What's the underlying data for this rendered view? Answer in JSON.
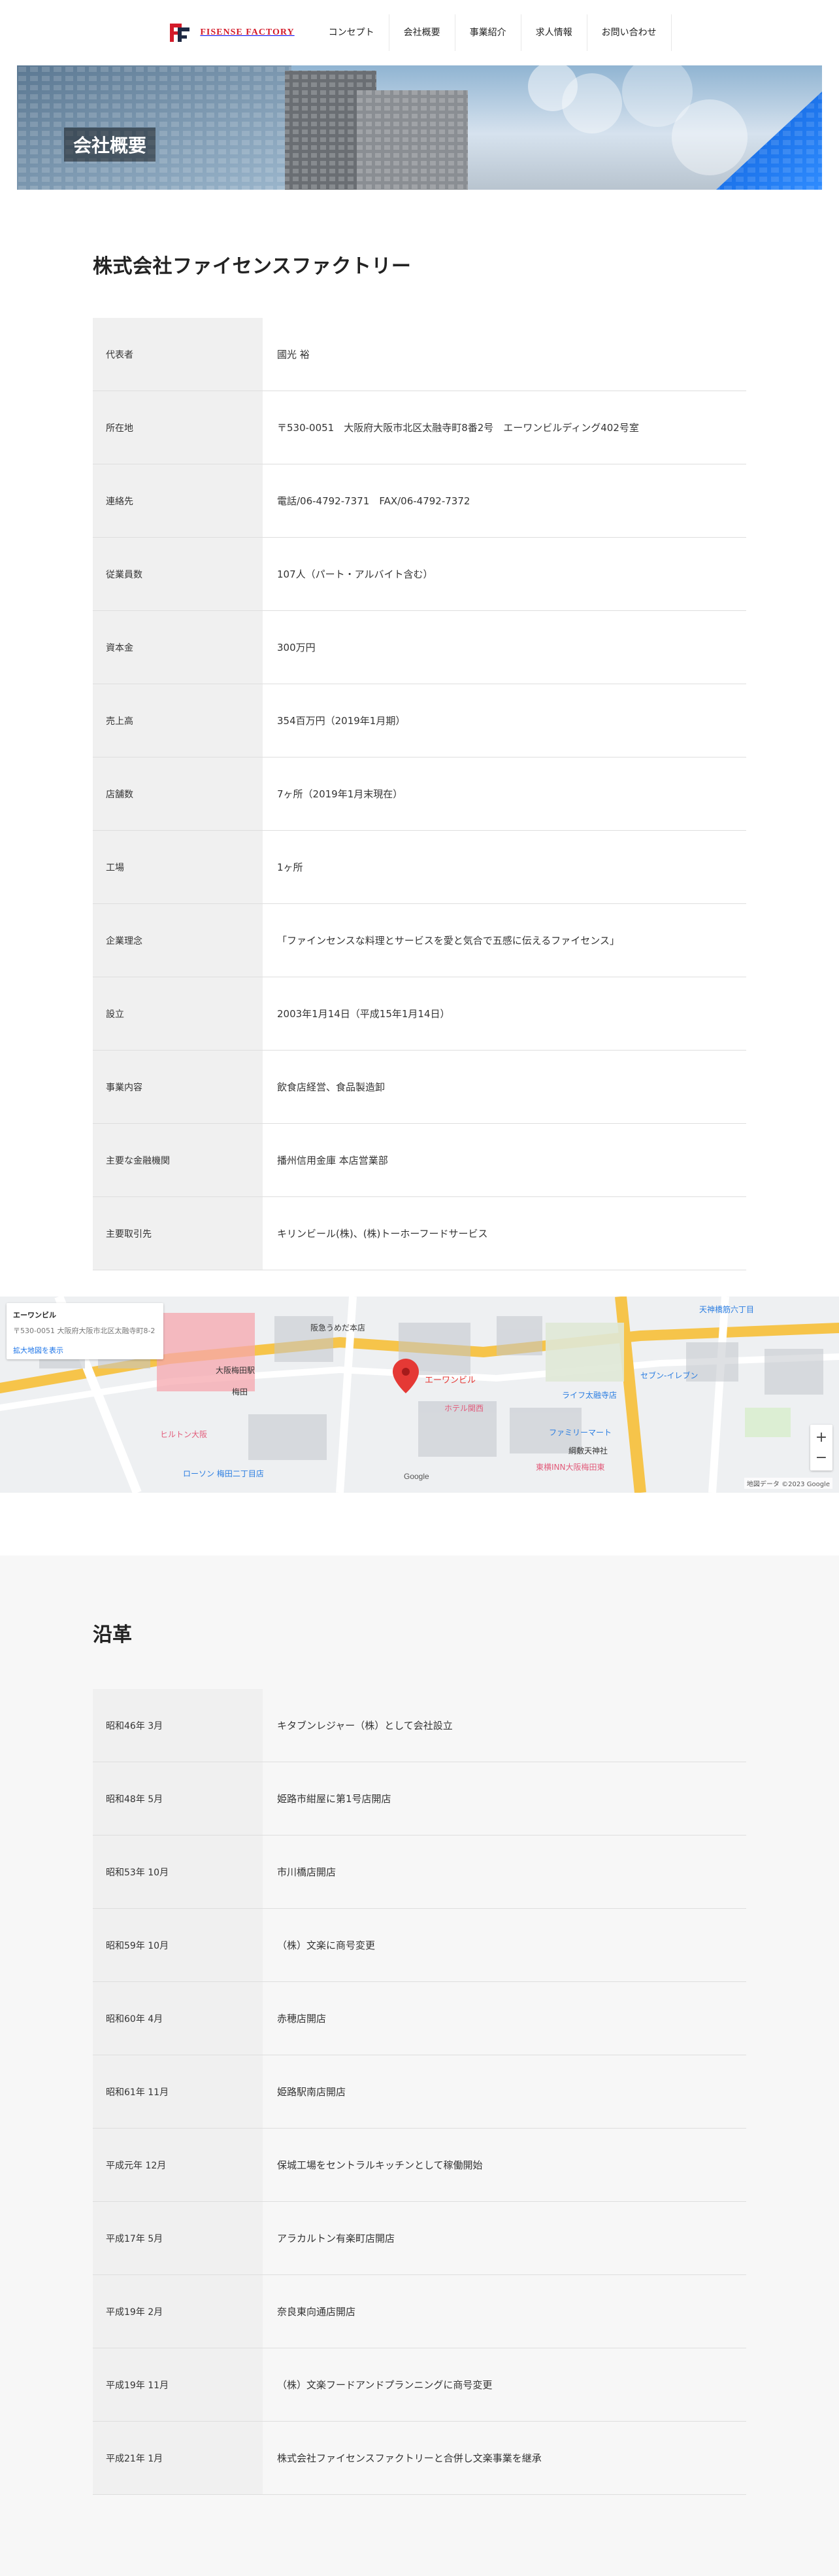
{
  "header": {
    "logo_text": "FISENSE FACTORY",
    "nav": [
      {
        "label": "コンセプト"
      },
      {
        "label": "会社概要"
      },
      {
        "label": "事業紹介"
      },
      {
        "label": "求人情報"
      },
      {
        "label": "お問い合わせ"
      }
    ]
  },
  "hero": {
    "badge": "会社概要"
  },
  "company": {
    "name": "株式会社ファイセンスファクトリー",
    "rows": [
      {
        "label": "代表者",
        "value": "國光 裕"
      },
      {
        "label": "所在地",
        "value": "〒530-0051　大阪府大阪市北区太融寺町8番2号　エーワンビルディング402号室"
      },
      {
        "label": "連絡先",
        "value": "電話/06-4792-7371　FAX/06-4792-7372"
      },
      {
        "label": "従業員数",
        "value": "107人（パート・アルバイト含む）"
      },
      {
        "label": "資本金",
        "value": "300万円"
      },
      {
        "label": "売上高",
        "value": "354百万円（2019年1月期）"
      },
      {
        "label": "店舗数",
        "value": "7ヶ所（2019年1月末現在）"
      },
      {
        "label": "工場",
        "value": "1ヶ所"
      },
      {
        "label": "企業理念",
        "value": "「ファインセンスな料理とサービスを愛と気合で五感に伝えるファイセンス」"
      },
      {
        "label": "設立",
        "value": "2003年1月14日（平成15年1月14日）"
      },
      {
        "label": "事業内容",
        "value": "飲食店経営、食品製造卸"
      },
      {
        "label": "主要な金融機関",
        "value": "播州信用金庫 本店営業部"
      },
      {
        "label": "主要取引先",
        "value": "キリンビール(株)、(株)トーホーフードサービス"
      }
    ]
  },
  "map": {
    "card_line1": "エーワンビル",
    "card_line2": "〒530-0051 大阪府大阪市北区太融寺町8-2",
    "card_line3": "拡大地図を表示",
    "pin_label": "エーワンビル",
    "google_label": "Google",
    "credit": "地図データ ©2023 Google",
    "zoom_in": "+",
    "zoom_out": "−",
    "place_labels": [
      {
        "text": "阪急うめだ本店"
      },
      {
        "text": "大阪梅田駅"
      },
      {
        "text": "梅田"
      },
      {
        "text": "ヒルトン大阪"
      },
      {
        "text": "ファミリーマート"
      },
      {
        "text": "セブン-イレブン"
      },
      {
        "text": "ホテル関西"
      },
      {
        "text": "ライフ太融寺店"
      },
      {
        "text": "東横INN大阪梅田東"
      },
      {
        "text": "綱敷天神社"
      },
      {
        "text": "ローソン 梅田二丁目店"
      },
      {
        "text": "天神橋筋六丁目"
      }
    ]
  },
  "history": {
    "title": "沿革",
    "rows": [
      {
        "date": "昭和46年 3月",
        "event": "キタブンレジャー（株）として会社設立"
      },
      {
        "date": "昭和48年 5月",
        "event": "姫路市紺屋に第1号店開店"
      },
      {
        "date": "昭和53年 10月",
        "event": "市川橋店開店"
      },
      {
        "date": "昭和59年 10月",
        "event": "（株）文楽に商号変更"
      },
      {
        "date": "昭和60年 4月",
        "event": "赤穂店開店"
      },
      {
        "date": "昭和61年 11月",
        "event": "姫路駅南店開店"
      },
      {
        "date": "平成元年 12月",
        "event": "保城工場をセントラルキッチンとして稼働開始"
      },
      {
        "date": "平成17年 5月",
        "event": "アラカルトン有楽町店開店"
      },
      {
        "date": "平成19年 2月",
        "event": "奈良東向通店開店"
      },
      {
        "date": "平成19年 11月",
        "event": "（株）文楽フードアンドプランニングに商号変更"
      },
      {
        "date": "平成21年 1月",
        "event": "株式会社ファイセンスファクトリーと合併し文楽事業を継承"
      }
    ]
  }
}
